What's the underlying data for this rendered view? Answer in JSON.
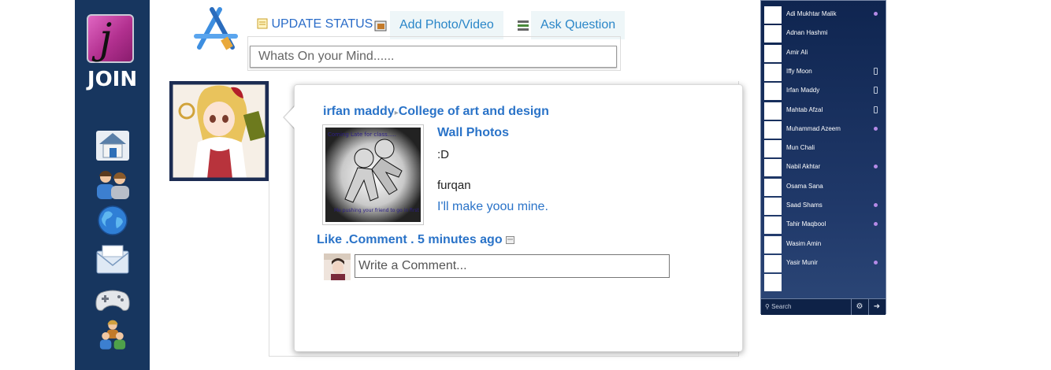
{
  "nav": {
    "join_label": "JOIN",
    "logo_letter": "j",
    "icons": [
      "home-icon",
      "friends-icon",
      "globe-icon",
      "messages-icon",
      "games-icon",
      "groups-icon"
    ]
  },
  "status_bar": {
    "update_status_label": "UPDATE STATUS",
    "add_photo_label": "Add Photo/Video",
    "ask_question_label": "Ask Question",
    "input_placeholder": "Whats On your Mind......"
  },
  "post": {
    "author": "irfan maddy",
    "separator": "▸",
    "target": "College of art and design",
    "album": "Wall Photos",
    "caption": ":D",
    "commenter": "furqan",
    "comment_text": "I'll make yoou mine.",
    "photo_text_top": "Coming Late for class.....",
    "photo_text_bottom": "Me pushing your friend to go in first",
    "actions": "Like .Comment . 5 minutes ago",
    "comment_placeholder": "Write a Comment..."
  },
  "chat": {
    "contacts": [
      {
        "name": "Adi Mukhtar Malik",
        "status": "online"
      },
      {
        "name": "Adnan Hashmi",
        "status": "none"
      },
      {
        "name": "Amir Ali",
        "status": "none"
      },
      {
        "name": "Iffy Moon",
        "status": "mobile"
      },
      {
        "name": "Irfan Maddy",
        "status": "mobile"
      },
      {
        "name": "Mahtab Afzal",
        "status": "mobile"
      },
      {
        "name": "Muhammad Azeem",
        "status": "online"
      },
      {
        "name": "Mun Chali",
        "status": "none"
      },
      {
        "name": "Nabil Akhtar",
        "status": "online"
      },
      {
        "name": "Osama Sana",
        "status": "none"
      },
      {
        "name": "Saad Shams",
        "status": "online"
      },
      {
        "name": "Tahir Maqbool",
        "status": "online"
      },
      {
        "name": "Wasim Amin",
        "status": "none"
      },
      {
        "name": "Yasir Munir",
        "status": "online"
      },
      {
        "name": "",
        "status": "none"
      }
    ],
    "search_label": "Search",
    "settings_icon": "gear-icon",
    "popout_icon": "popout-icon"
  },
  "colors": {
    "nav_bg": "#17365f",
    "link": "#2a73c8",
    "chat_bg": "#1a3263",
    "online_dot": "#b58ae6"
  }
}
